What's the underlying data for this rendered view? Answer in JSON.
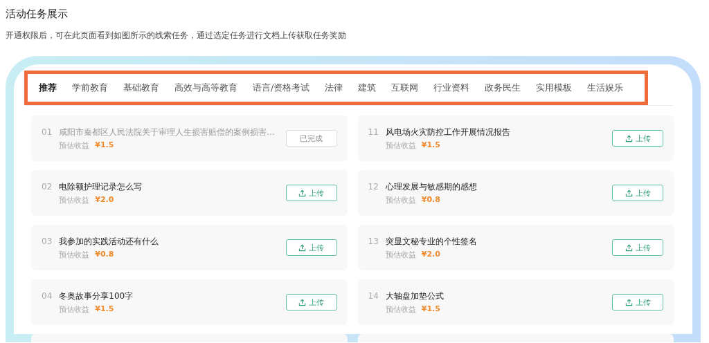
{
  "page": {
    "title": "活动任务展示",
    "description": "开通权限后，可在此页面看到如图所示的线索任务，通过选定任务进行文档上传获取任务奖励"
  },
  "tabs": [
    {
      "label": "推荐",
      "selected": true
    },
    {
      "label": "学前教育",
      "selected": false
    },
    {
      "label": "基础教育",
      "selected": false
    },
    {
      "label": "高效与高等教育",
      "selected": false
    },
    {
      "label": "语言/资格考试",
      "selected": false
    },
    {
      "label": "法律",
      "selected": false
    },
    {
      "label": "建筑",
      "selected": false
    },
    {
      "label": "互联网",
      "selected": false
    },
    {
      "label": "行业资料",
      "selected": false
    },
    {
      "label": "政务民生",
      "selected": false
    },
    {
      "label": "实用模板",
      "selected": false
    },
    {
      "label": "生活娱乐",
      "selected": false
    }
  ],
  "task_columns": [
    [
      {
        "number": "01",
        "title": "咸阳市秦都区人民法院关于审理人生损害赔偿的案例损害...",
        "reward_label": "预估收益",
        "reward": "¥1.5",
        "done": true,
        "button": "已完成"
      },
      {
        "number": "02",
        "title": "电除额护理记录怎么写",
        "reward_label": "预估收益",
        "reward": "¥2.0",
        "done": false,
        "button": "上传"
      },
      {
        "number": "03",
        "title": "我参加的实践活动还有什么",
        "reward_label": "预估收益",
        "reward": "¥0.8",
        "done": false,
        "button": "上传"
      },
      {
        "number": "04",
        "title": "冬奥故事分享100字",
        "reward_label": "预估收益",
        "reward": "¥1.5",
        "done": false,
        "button": "上传"
      }
    ],
    [
      {
        "number": "11",
        "title": "风电场火灾防控工作开展情况报告",
        "reward_label": "预估收益",
        "reward": "¥1.5",
        "done": false,
        "button": "上传"
      },
      {
        "number": "12",
        "title": "心理发展与敏感期的感想",
        "reward_label": "预估收益",
        "reward": "¥0.8",
        "done": false,
        "button": "上传"
      },
      {
        "number": "13",
        "title": "突显文秘专业的个性签名",
        "reward_label": "预估收益",
        "reward": "¥2.0",
        "done": false,
        "button": "上传"
      },
      {
        "number": "14",
        "title": "大轴盘加垫公式",
        "reward_label": "预估收益",
        "reward": "¥1.5",
        "done": false,
        "button": "上传"
      }
    ]
  ]
}
